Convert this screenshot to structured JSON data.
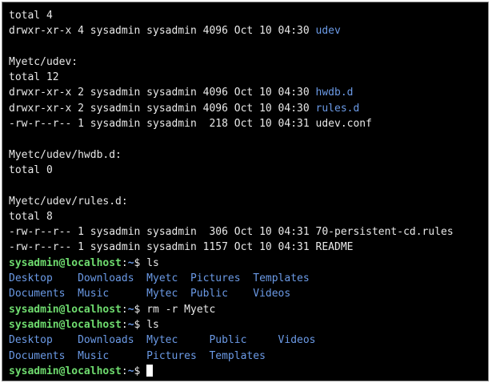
{
  "terminal": {
    "lines": [
      {
        "segments": [
          {
            "text": "total 4",
            "type": "plain"
          }
        ]
      },
      {
        "segments": [
          {
            "text": "drwxr-xr-x 4 sysadmin sysadmin 4096 Oct 10 04:30 ",
            "type": "plain"
          },
          {
            "text": "udev",
            "type": "dir"
          }
        ]
      },
      {
        "segments": []
      },
      {
        "segments": [
          {
            "text": "Myetc/udev:",
            "type": "plain"
          }
        ]
      },
      {
        "segments": [
          {
            "text": "total 12",
            "type": "plain"
          }
        ]
      },
      {
        "segments": [
          {
            "text": "drwxr-xr-x 2 sysadmin sysadmin 4096 Oct 10 04:30 ",
            "type": "plain"
          },
          {
            "text": "hwdb.d",
            "type": "dir"
          }
        ]
      },
      {
        "segments": [
          {
            "text": "drwxr-xr-x 2 sysadmin sysadmin 4096 Oct 10 04:30 ",
            "type": "plain"
          },
          {
            "text": "rules.d",
            "type": "dir"
          }
        ]
      },
      {
        "segments": [
          {
            "text": "-rw-r--r-- 1 sysadmin sysadmin  218 Oct 10 04:31 udev.conf",
            "type": "plain"
          }
        ]
      },
      {
        "segments": []
      },
      {
        "segments": [
          {
            "text": "Myetc/udev/hwdb.d:",
            "type": "plain"
          }
        ]
      },
      {
        "segments": [
          {
            "text": "total 0",
            "type": "plain"
          }
        ]
      },
      {
        "segments": []
      },
      {
        "segments": [
          {
            "text": "Myetc/udev/rules.d:",
            "type": "plain"
          }
        ]
      },
      {
        "segments": [
          {
            "text": "total 8",
            "type": "plain"
          }
        ]
      },
      {
        "segments": [
          {
            "text": "-rw-r--r-- 1 sysadmin sysadmin  306 Oct 10 04:31 70-persistent-cd.rules",
            "type": "plain"
          }
        ]
      },
      {
        "segments": [
          {
            "text": "-rw-r--r-- 1 sysadmin sysadmin 1157 Oct 10 04:31 README",
            "type": "plain"
          }
        ]
      },
      {
        "segments": [
          {
            "text": "sysadmin@localhost",
            "type": "prompt-user"
          },
          {
            "text": ":",
            "type": "plain"
          },
          {
            "text": "~",
            "type": "prompt-path"
          },
          {
            "text": "$ ls",
            "type": "plain"
          }
        ]
      },
      {
        "segments": [
          {
            "text": "Desktop    Downloads  Myetc  Pictures  Templates",
            "type": "dir"
          }
        ]
      },
      {
        "segments": [
          {
            "text": "Documents  Music      Mytec  Public    Videos",
            "type": "dir"
          }
        ]
      },
      {
        "segments": [
          {
            "text": "sysadmin@localhost",
            "type": "prompt-user"
          },
          {
            "text": ":",
            "type": "plain"
          },
          {
            "text": "~",
            "type": "prompt-path"
          },
          {
            "text": "$ rm -r Myetc",
            "type": "plain"
          }
        ]
      },
      {
        "segments": [
          {
            "text": "sysadmin@localhost",
            "type": "prompt-user"
          },
          {
            "text": ":",
            "type": "plain"
          },
          {
            "text": "~",
            "type": "prompt-path"
          },
          {
            "text": "$ ls",
            "type": "plain"
          }
        ]
      },
      {
        "segments": [
          {
            "text": "Desktop    Downloads  Mytec     Public     Videos",
            "type": "dir"
          }
        ]
      },
      {
        "segments": [
          {
            "text": "Documents  Music      Pictures  Templates",
            "type": "dir"
          }
        ]
      },
      {
        "segments": [
          {
            "text": "sysadmin@localhost",
            "type": "prompt-user"
          },
          {
            "text": ":",
            "type": "plain"
          },
          {
            "text": "~",
            "type": "prompt-path"
          },
          {
            "text": "$ ",
            "type": "plain"
          }
        ],
        "cursor": true
      }
    ]
  }
}
